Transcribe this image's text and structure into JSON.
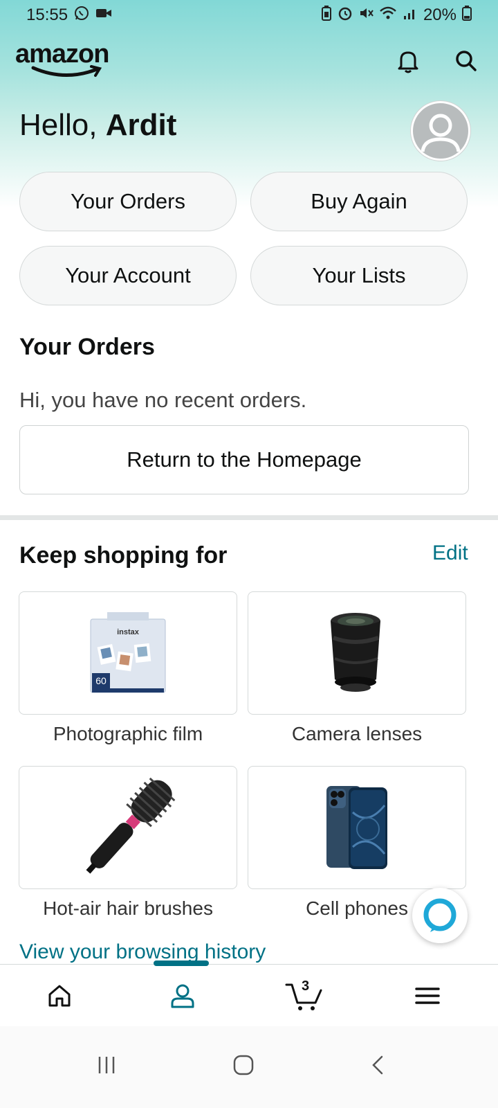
{
  "status_bar": {
    "time": "15:55",
    "battery": "20%",
    "left_icons": [
      "whatsapp-icon",
      "video-icon"
    ],
    "right_icons": [
      "battery-saver-icon",
      "alarm-icon",
      "mute-icon",
      "wifi-icon",
      "signal-icon"
    ]
  },
  "header": {
    "logo": "amazon",
    "icons": [
      "bell-icon",
      "search-icon"
    ]
  },
  "greeting": {
    "prefix": "Hello, ",
    "name": "Ardit"
  },
  "quick_actions": {
    "your_orders": "Your Orders",
    "buy_again": "Buy Again",
    "your_account": "Your Account",
    "your_lists": "Your Lists"
  },
  "orders": {
    "title": "Your Orders",
    "message": "Hi, you have no recent orders.",
    "home_button": "Return to the Homepage"
  },
  "keep_shopping": {
    "title": "Keep shopping for",
    "edit": "Edit",
    "items": [
      {
        "label": "Photographic film",
        "icon": "instax-film-image"
      },
      {
        "label": "Camera lenses",
        "icon": "camera-lens-image"
      },
      {
        "label": "Hot-air hair brushes",
        "icon": "hair-brush-image"
      },
      {
        "label": "Cell phones",
        "icon": "smartphone-image"
      }
    ],
    "browsing_history": "View your browsing history"
  },
  "bottom_nav": {
    "items": [
      "home-icon",
      "account-icon",
      "cart-icon",
      "menu-icon"
    ],
    "cart_count": "3"
  },
  "colors": {
    "link": "#007185",
    "text": "#0f1111",
    "border": "#d5d9d9"
  }
}
